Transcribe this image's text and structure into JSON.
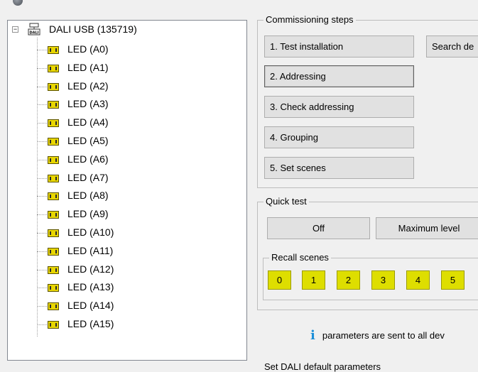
{
  "tree": {
    "root_label": "DALI USB (135719)",
    "expander": "−",
    "children": [
      "LED (A0)",
      "LED (A1)",
      "LED (A2)",
      "LED (A3)",
      "LED (A4)",
      "LED (A5)",
      "LED (A6)",
      "LED (A7)",
      "LED (A8)",
      "LED (A9)",
      "LED (A10)",
      "LED (A11)",
      "LED (A12)",
      "LED (A13)",
      "LED (A14)",
      "LED (A15)"
    ]
  },
  "commissioning": {
    "legend": "Commissioning steps",
    "steps": [
      "1. Test installation",
      "2. Addressing",
      "3. Check addressing",
      "4. Grouping",
      "5. Set scenes"
    ],
    "search_button": "Search de"
  },
  "quick_test": {
    "legend": "Quick test",
    "off_label": "Off",
    "max_label": "Maximum level",
    "recall_legend": "Recall scenes",
    "scenes": [
      "0",
      "1",
      "2",
      "3",
      "4",
      "5"
    ]
  },
  "info_text": "parameters are sent to all dev",
  "bottom_text": "Set DALI default parameters",
  "colors": {
    "scene_button": "#dede00",
    "led_icon": "#e8d600",
    "info_icon": "#1c8fd8"
  }
}
